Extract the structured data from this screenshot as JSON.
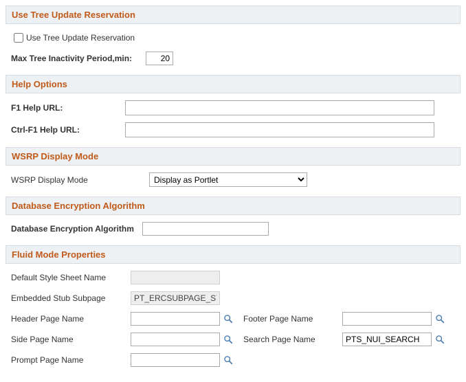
{
  "tree": {
    "header": "Use Tree Update Reservation",
    "checkbox_label": "Use Tree Update Reservation",
    "checkbox_checked": false,
    "period_label": "Max Tree Inactivity Period,min:",
    "period_value": "20"
  },
  "help": {
    "header": "Help Options",
    "f1_label": "F1 Help URL:",
    "f1_value": "",
    "ctrl_label": "Ctrl-F1 Help URL:",
    "ctrl_value": ""
  },
  "wsrp": {
    "header": "WSRP Display Mode",
    "label": "WSRP Display Mode",
    "selected": "Display as Portlet"
  },
  "dbenc": {
    "header": "Database Encryption Algorithm",
    "label": "Database Encryption Algorithm",
    "value": ""
  },
  "fluid": {
    "header": "Fluid Mode Properties",
    "default_style_label": "Default Style Sheet Name",
    "default_style_value": "",
    "embedded_stub_label": "Embedded Stub Subpage",
    "embedded_stub_value": "PT_ERCSUBPAGE_STUB",
    "header_page_label": "Header Page Name",
    "header_page_value": "",
    "footer_page_label": "Footer Page Name",
    "footer_page_value": "",
    "side_page_label": "Side Page Name",
    "side_page_value": "",
    "search_page_label": "Search Page Name",
    "search_page_value": "PTS_NUI_SEARCH",
    "prompt_page_label": "Prompt Page Name",
    "prompt_page_value": ""
  }
}
